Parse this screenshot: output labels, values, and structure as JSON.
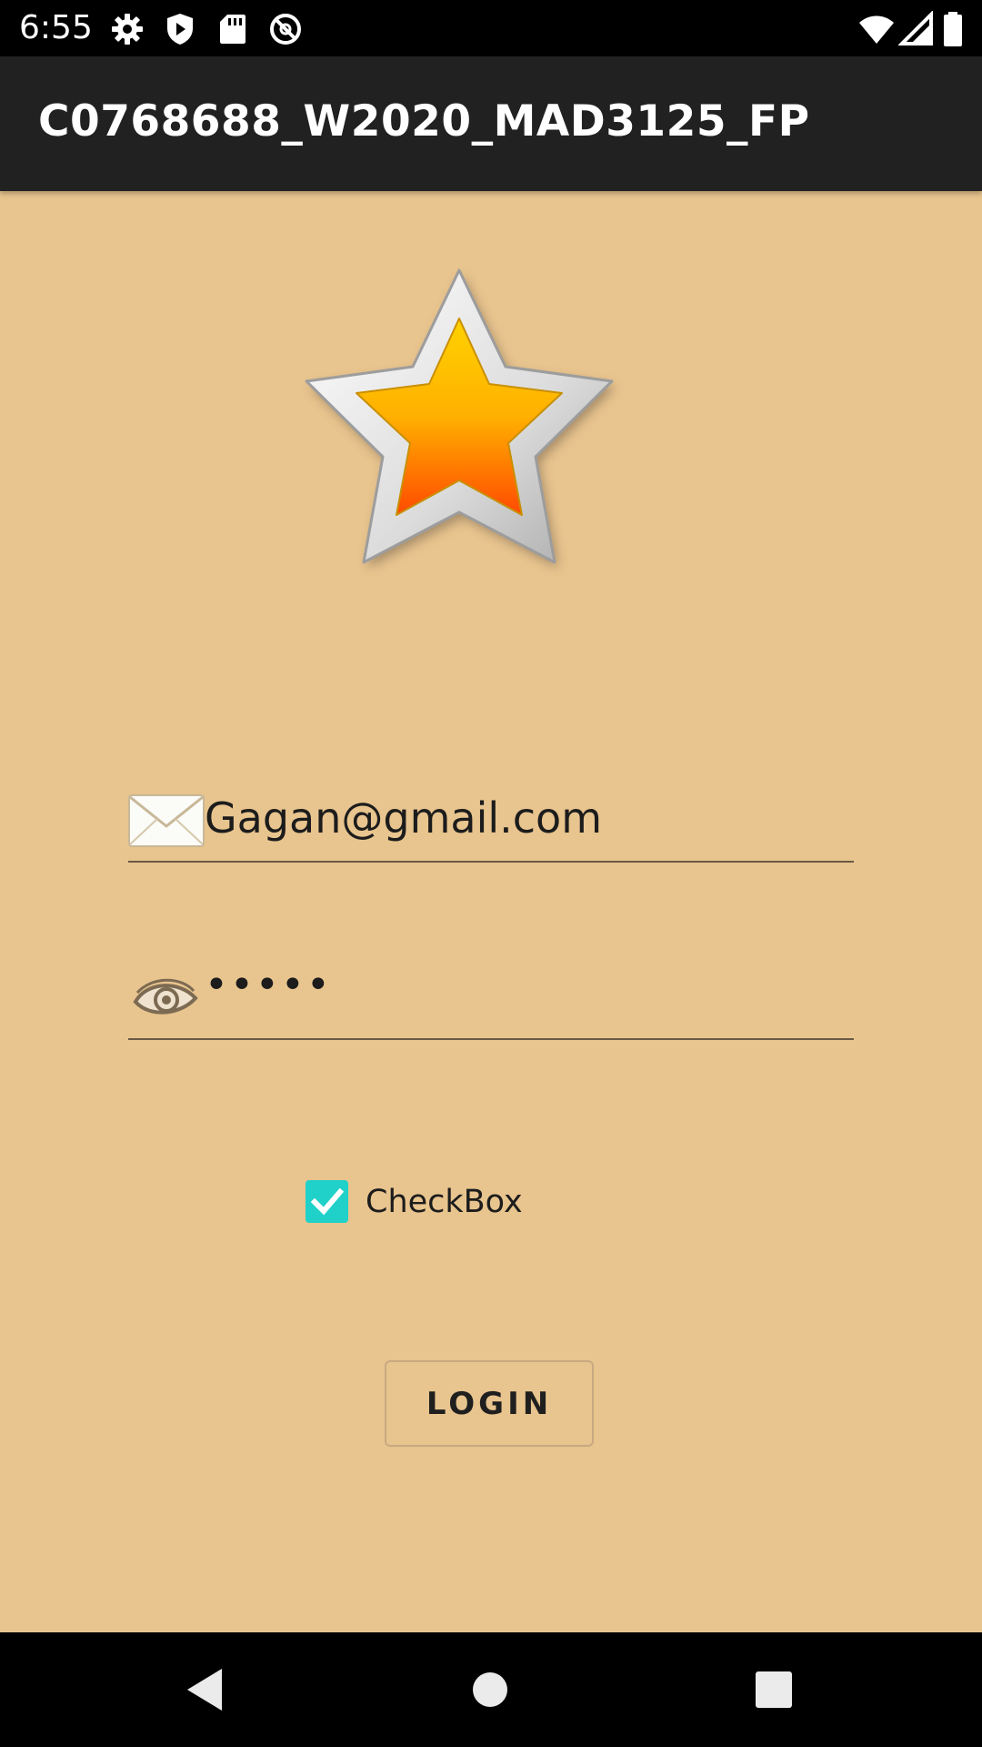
{
  "status_bar": {
    "time": "6:55",
    "left_icons": [
      "settings-icon",
      "play-protect-icon",
      "sd-card-icon",
      "no-disturb-icon"
    ],
    "right_icons": [
      "wifi-icon",
      "cellular-icon",
      "battery-icon"
    ]
  },
  "app_bar": {
    "title": "C0768688_W2020_MAD3125_FP"
  },
  "logo": {
    "icon": "star-icon",
    "colors": {
      "outer": "#d8d8d8",
      "inner_top": "#FFC700",
      "inner_bottom": "#FF5A00"
    }
  },
  "form": {
    "email": {
      "icon": "mail-icon",
      "value": "Gagan@gmail.com"
    },
    "password": {
      "icon": "eye-icon",
      "value": "•••••"
    },
    "checkbox": {
      "label": "CheckBox",
      "checked": true,
      "color": "#1FD1C8"
    },
    "login_label": "LOGIN"
  },
  "nav_bar": {
    "icons": [
      "back-icon",
      "home-icon",
      "recents-icon"
    ]
  },
  "colors": {
    "background": "#E8C48E",
    "app_bar": "#212121",
    "accent": "#1FD1C8"
  }
}
